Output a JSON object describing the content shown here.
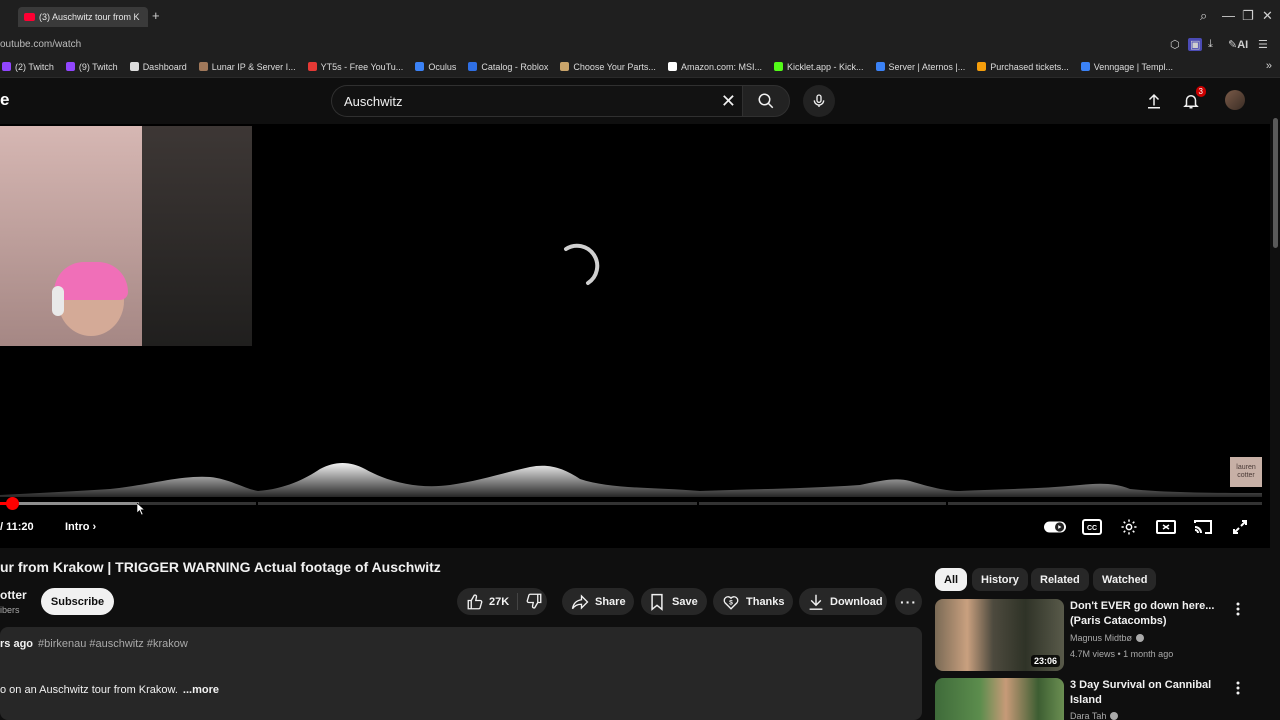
{
  "browser": {
    "tab_title": "(3) Auschwitz tour from K",
    "new_tab": "+",
    "url": "outube.com/watch",
    "ai_label": "AI",
    "bookmarks": [
      {
        "label": "(2) Twitch",
        "color": "#9146ff"
      },
      {
        "label": "(9) Twitch",
        "color": "#9146ff"
      },
      {
        "label": "Dashboard",
        "color": "#dddddd"
      },
      {
        "label": "Lunar IP & Server I...",
        "color": "#a0785a"
      },
      {
        "label": "YT5s - Free YouTu...",
        "color": "#e53935"
      },
      {
        "label": "Oculus",
        "color": "#3b82f6"
      },
      {
        "label": "Catalog - Roblox",
        "color": "#2f6fe4"
      },
      {
        "label": "Choose Your Parts...",
        "color": "#c9a46a"
      },
      {
        "label": "Amazon.com: MSI...",
        "color": "#ffffff"
      },
      {
        "label": "Kicklet.app - Kick...",
        "color": "#53fc18"
      },
      {
        "label": "Server | Aternos |...",
        "color": "#3b82f6"
      },
      {
        "label": "Purchased tickets...",
        "color": "#f59e0b"
      },
      {
        "label": "Venngage | Templ...",
        "color": "#3b82f6"
      }
    ]
  },
  "header": {
    "logo_fragment": "e",
    "search_value": "Auschwitz",
    "notification_count": "3"
  },
  "player": {
    "time": "/ 11:20",
    "chapter": "Intro",
    "watermark_line1": "lauren",
    "watermark_line2": "cotter",
    "played_fraction": 0.008,
    "buffered_fraction": 0.11
  },
  "video": {
    "title": "ur from Krakow | TRIGGER WARNING Actual footage of Auschwitz",
    "channel": "otter",
    "subscribers": "ibers",
    "subscribe_label": "Subscribe",
    "likes": "27K",
    "share_label": "Share",
    "save_label": "Save",
    "thanks_label": "Thanks",
    "download_label": "Download",
    "description_date": "rs ago",
    "description_tags": "#birkenau #auschwitz #krakow",
    "description_text": "o on an Auschwitz tour from Krakow.",
    "description_more": "...more"
  },
  "sidebar": {
    "chips": [
      "All",
      "History",
      "Related",
      "Watched"
    ],
    "recommendations": [
      {
        "title": "Don't EVER go down here... (Paris Catacombs)",
        "channel": "Magnus Midtbø",
        "stats": "4.7M views • 1 month ago",
        "duration": "23:06"
      },
      {
        "title": "3 Day Survival on Cannibal Island",
        "channel": "Dara Tah",
        "stats": "",
        "duration": ""
      }
    ]
  },
  "colors": {
    "accent_red": "#ff0000",
    "background": "#0f0f0f",
    "surface": "#272727"
  }
}
